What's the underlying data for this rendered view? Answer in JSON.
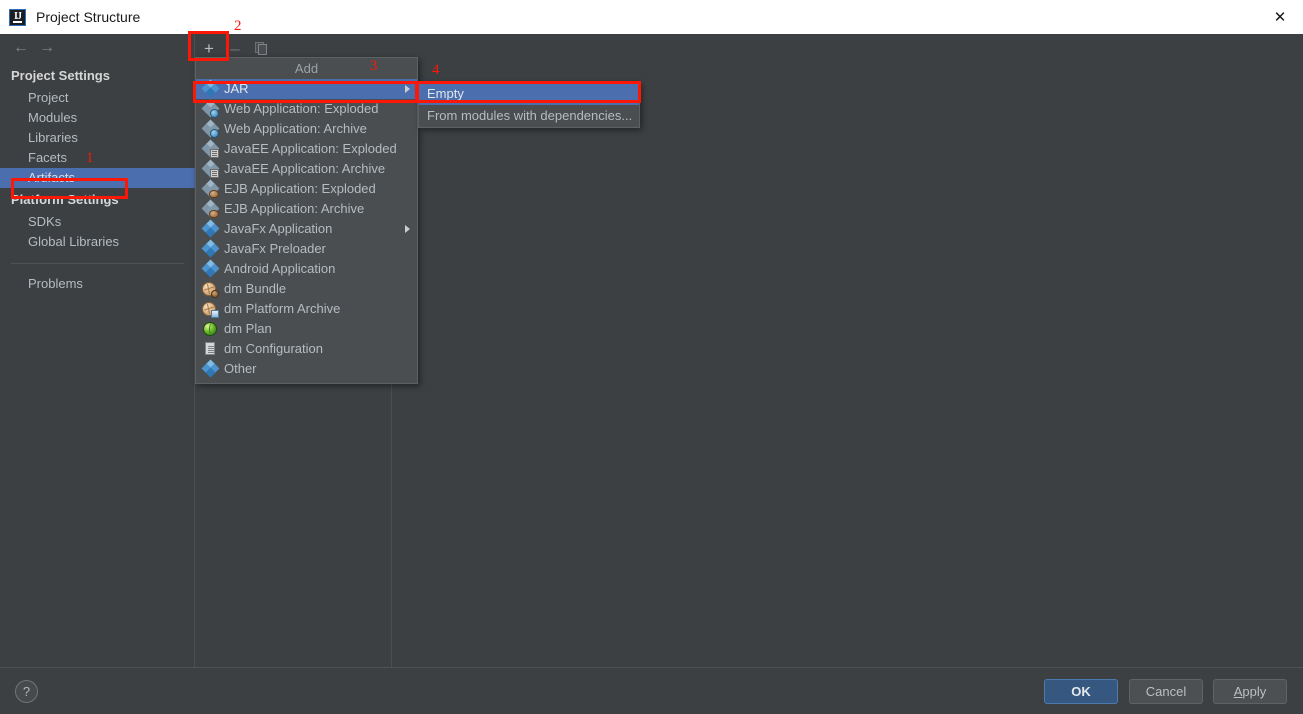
{
  "window": {
    "title": "Project Structure",
    "app_icon": "intellij-idea-icon",
    "close_icon": "close-icon"
  },
  "nav_toolbar": {
    "back_icon": "arrow-left-icon",
    "forward_icon": "arrow-right-icon"
  },
  "sidebar": {
    "groups": [
      {
        "title": "Project Settings",
        "items": [
          {
            "label": "Project",
            "selected": false
          },
          {
            "label": "Modules",
            "selected": false
          },
          {
            "label": "Libraries",
            "selected": false
          },
          {
            "label": "Facets",
            "selected": false
          },
          {
            "label": "Artifacts",
            "selected": true
          }
        ]
      },
      {
        "title": "Platform Settings",
        "items": [
          {
            "label": "SDKs",
            "selected": false
          },
          {
            "label": "Global Libraries",
            "selected": false
          }
        ]
      }
    ],
    "extra_items": [
      {
        "label": "Problems",
        "selected": false
      }
    ]
  },
  "artifacts_toolbar": {
    "add_label": "+",
    "remove_label": "–",
    "copy_icon": "copy-icon"
  },
  "add_popup": {
    "header": "Add",
    "items": [
      {
        "label": "JAR",
        "icon": "jar-icon",
        "highlighted": true,
        "has_submenu": true
      },
      {
        "label": "Web Application: Exploded",
        "icon": "web-application-exploded-icon",
        "highlighted": false,
        "has_submenu": false
      },
      {
        "label": "Web Application: Archive",
        "icon": "web-application-archive-icon",
        "highlighted": false,
        "has_submenu": false
      },
      {
        "label": "JavaEE Application: Exploded",
        "icon": "javaee-application-exploded-icon",
        "highlighted": false,
        "has_submenu": false
      },
      {
        "label": "JavaEE Application: Archive",
        "icon": "javaee-application-archive-icon",
        "highlighted": false,
        "has_submenu": false
      },
      {
        "label": "EJB Application: Exploded",
        "icon": "ejb-application-exploded-icon",
        "highlighted": false,
        "has_submenu": false
      },
      {
        "label": "EJB Application: Archive",
        "icon": "ejb-application-archive-icon",
        "highlighted": false,
        "has_submenu": false
      },
      {
        "label": "JavaFx Application",
        "icon": "javafx-application-icon",
        "highlighted": false,
        "has_submenu": true
      },
      {
        "label": "JavaFx Preloader",
        "icon": "javafx-preloader-icon",
        "highlighted": false,
        "has_submenu": false
      },
      {
        "label": "Android Application",
        "icon": "android-application-icon",
        "highlighted": false,
        "has_submenu": false
      },
      {
        "label": "dm Bundle",
        "icon": "dm-bundle-icon",
        "highlighted": false,
        "has_submenu": false
      },
      {
        "label": "dm Platform Archive",
        "icon": "dm-platform-archive-icon",
        "highlighted": false,
        "has_submenu": false
      },
      {
        "label": "dm Plan",
        "icon": "dm-plan-icon",
        "highlighted": false,
        "has_submenu": false
      },
      {
        "label": "dm Configuration",
        "icon": "dm-configuration-icon",
        "highlighted": false,
        "has_submenu": false
      },
      {
        "label": "Other",
        "icon": "other-icon",
        "highlighted": false,
        "has_submenu": false
      }
    ]
  },
  "jar_submenu": {
    "items": [
      {
        "label": "Empty",
        "highlighted": true
      },
      {
        "label": "From modules with dependencies...",
        "highlighted": false
      }
    ]
  },
  "footer": {
    "help_label": "?",
    "ok_label": "OK",
    "cancel_label": "Cancel",
    "apply_mnemonic": "A",
    "apply_rest": "pply"
  },
  "annotations": [
    {
      "number": "1"
    },
    {
      "number": "2"
    },
    {
      "number": "3"
    },
    {
      "number": "4"
    }
  ],
  "colors": {
    "selection_blue": "#4b6eaf",
    "annotation_red": "#fc1707",
    "dialog_bg": "#3c4043",
    "popup_bg": "#4a4e51",
    "primary_button": "#365880"
  }
}
